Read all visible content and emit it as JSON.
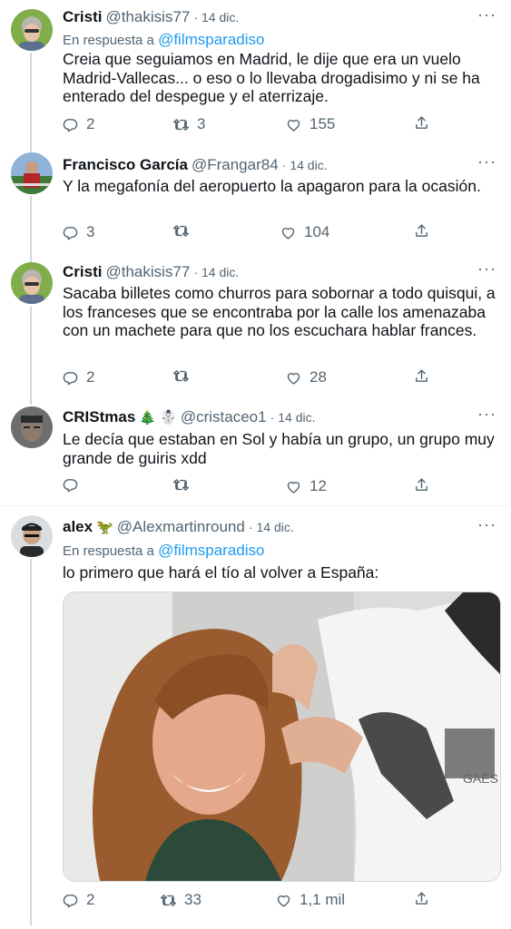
{
  "tweets": [
    {
      "name": "Cristi",
      "handle": "@thakisis77",
      "sep": "·",
      "date": "14 dic.",
      "reply_prefix": "En respuesta a",
      "reply_to": "@filmsparadiso",
      "text": "Creia que seguiamos en Madrid, le dije que era un vuelo Madrid-Vallecas... o eso o lo llevaba drogadisimo y ni se ha enterado del despegue y el aterrizaje.",
      "replies": "2",
      "retweets": "3",
      "likes": "155"
    },
    {
      "name": "Francisco García",
      "handle": "@Frangar84",
      "sep": "·",
      "date": "14 dic.",
      "text": "Y la megafonía del aeropuerto la apagaron para la ocasión.",
      "replies": "3",
      "retweets": "",
      "likes": "104"
    },
    {
      "name": "Cristi",
      "handle": "@thakisis77",
      "sep": "·",
      "date": "14 dic.",
      "text": "Sacaba billetes como churros para sobornar a todo quisqui, a los franceses que se encontraba por la calle los amenazaba con un machete para que no los escuchara hablar frances.",
      "replies": "2",
      "retweets": "",
      "likes": "28"
    },
    {
      "name": "CRIStmas",
      "name_emojis": "🎄 ☃️",
      "handle": "@cristaceo1",
      "sep": "·",
      "date": "14 dic.",
      "text": "Le decía que estaban en Sol y había un grupo, un grupo muy grande de guiris xdd",
      "replies": "",
      "retweets": "",
      "likes": "12"
    },
    {
      "name": "alex",
      "name_emojis": "🦖",
      "handle": "@Alexmartinround",
      "sep": "·",
      "date": "14 dic.",
      "reply_prefix": "En respuesta a",
      "reply_to": "@filmsparadiso",
      "text": "lo primero que hará el tío al volver a España:",
      "replies": "2",
      "retweets": "33",
      "likes": "1,1 mil"
    }
  ],
  "icons": {
    "more": "more-icon",
    "reply": "reply-icon",
    "retweet": "retweet-icon",
    "like": "like-icon",
    "share": "share-icon"
  },
  "colors": {
    "link": "#1d9bf0",
    "secondary": "#536471",
    "text": "#0f1419",
    "line": "#cfd9de"
  },
  "media_logo": "GAES",
  "more_glyph": "···"
}
